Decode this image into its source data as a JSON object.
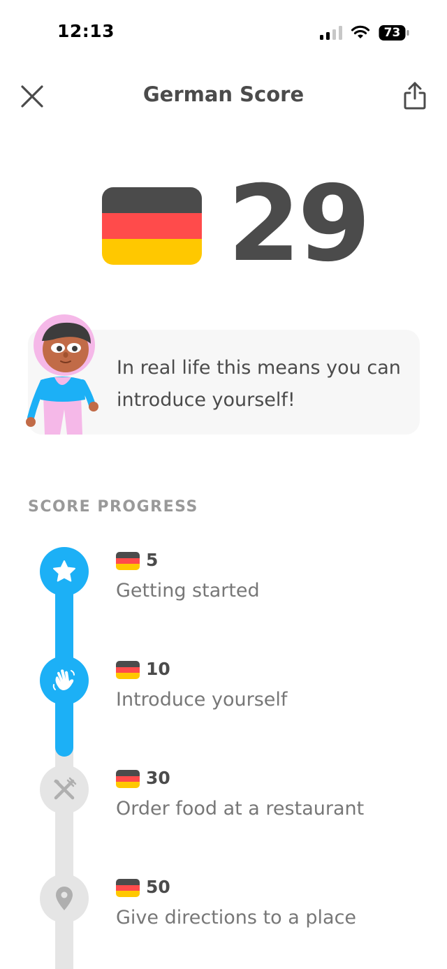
{
  "status_bar": {
    "time": "12:13",
    "battery": "73"
  },
  "header": {
    "title": "German Score",
    "close_icon": "close-icon",
    "share_icon": "share-icon"
  },
  "score": {
    "value": "29",
    "flag_icon": "germany-flag-icon"
  },
  "info_card": {
    "text": "In real life this means you can introduce yourself!",
    "character": "character-illustration"
  },
  "progress": {
    "section_label": "SCORE PROGRESS",
    "milestones": [
      {
        "value": "5",
        "label": "Getting started",
        "icon": "star-icon",
        "state": "completed"
      },
      {
        "value": "10",
        "label": "Introduce yourself",
        "icon": "wave-hand-icon",
        "state": "completed"
      },
      {
        "value": "30",
        "label": "Order food at a restaurant",
        "icon": "fork-knife-icon",
        "state": "locked"
      },
      {
        "value": "50",
        "label": "Give directions to a place",
        "icon": "map-pin-icon",
        "state": "locked"
      }
    ]
  },
  "colors": {
    "accent_blue": "#1cb0f6",
    "locked_grey": "#e5e5e5",
    "text_dark": "#4b4b4b",
    "text_muted": "#777777",
    "card_bg": "#f7f7f7"
  }
}
